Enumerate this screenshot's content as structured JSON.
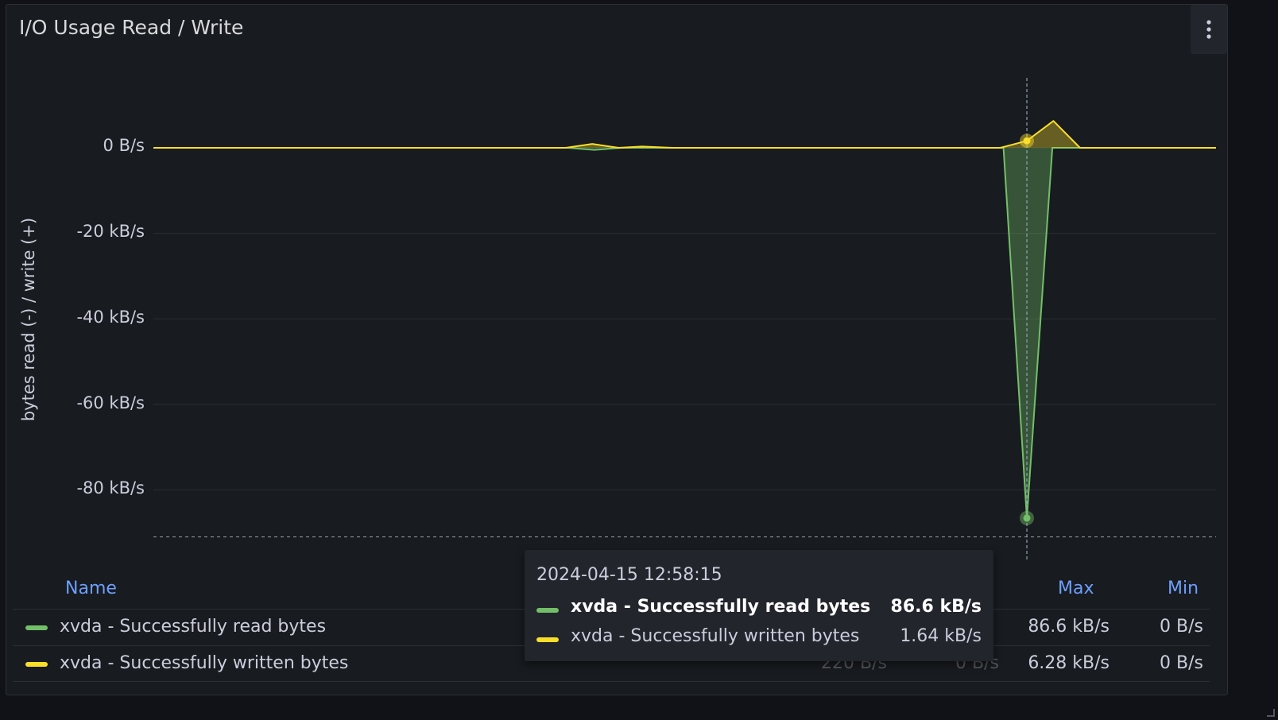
{
  "panel": {
    "title": "I/O Usage Read / Write",
    "menu_icon": "kebab-menu-icon"
  },
  "chart_data": {
    "type": "area",
    "ylabel": "bytes read (-) / write (+)",
    "y_ticks": [
      "0 B/s",
      "-20 kB/s",
      "-40 kB/s",
      "-60 kB/s",
      "-80 kB/s"
    ],
    "y_tick_values_kBps": [
      0,
      -20,
      -40,
      -60,
      -80
    ],
    "ylim_kBps": [
      -91,
      16
    ],
    "x_index_range": [
      0,
      100
    ],
    "series": [
      {
        "name": "xvda - Successfully read bytes",
        "color": "#73bf69",
        "points_kBps": [
          [
            0,
            0
          ],
          [
            39,
            0
          ],
          [
            41.5,
            -0.5
          ],
          [
            44,
            0
          ],
          [
            80,
            0
          ],
          [
            82.2,
            -86.6
          ],
          [
            84.6,
            0
          ],
          [
            100,
            0
          ]
        ]
      },
      {
        "name": "xvda - Successfully written bytes",
        "color": "#fade2a",
        "points_kBps": [
          [
            0,
            0
          ],
          [
            38.8,
            0
          ],
          [
            41.3,
            0.9
          ],
          [
            43.8,
            0
          ],
          [
            46,
            0.3
          ],
          [
            48.8,
            0
          ],
          [
            79.7,
            0
          ],
          [
            82.2,
            1.64
          ],
          [
            84.7,
            6.28
          ],
          [
            87.2,
            0
          ],
          [
            100,
            0
          ]
        ]
      }
    ],
    "hover_index": 82.2,
    "threshold_kBps": -91
  },
  "legend": {
    "headers": {
      "name": "Name",
      "max": "Max",
      "min": "Min"
    },
    "rows": [
      {
        "name": "xvda - Successfully read bytes",
        "color": "#73bf69",
        "hidden1": "",
        "hidden2": "",
        "max": "86.6 kB/s",
        "min": "0 B/s"
      },
      {
        "name": "xvda - Successfully written bytes",
        "color": "#fade2a",
        "hidden1": "220 B/s",
        "hidden2": "0 B/s",
        "max": "6.28 kB/s",
        "min": "0 B/s"
      }
    ]
  },
  "tooltip": {
    "timestamp": "2024-04-15 12:58:15",
    "rows": [
      {
        "name": "xvda - Successfully read bytes",
        "value": "86.6 kB/s",
        "color": "#73bf69"
      },
      {
        "name": "xvda - Successfully written bytes",
        "value": "1.64 kB/s",
        "color": "#fade2a"
      }
    ]
  }
}
